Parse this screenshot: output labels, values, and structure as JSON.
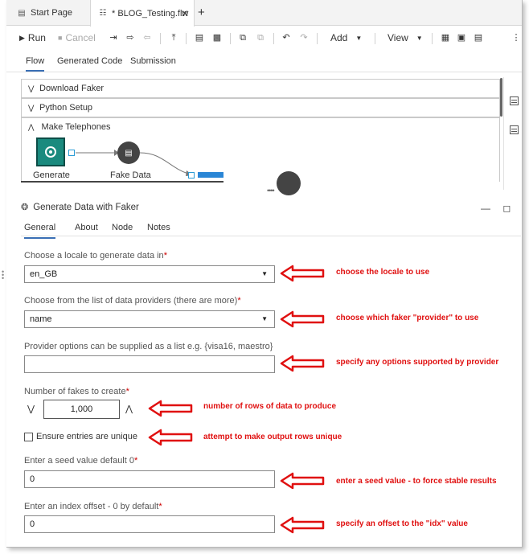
{
  "tabs": [
    {
      "label": "Start Page",
      "icon": "start-page-icon"
    },
    {
      "label": "* BLOG_Testing.flw",
      "icon": "flow-icon"
    }
  ],
  "toolbar": {
    "run": "Run",
    "cancel": "Cancel",
    "add": "Add",
    "view": "View"
  },
  "subtabs": [
    "Flow",
    "Generated Code",
    "Submission"
  ],
  "flow": {
    "rows": [
      "Download Faker",
      "Python Setup"
    ],
    "make_title": "Make Telephones",
    "node_generate": "Generate",
    "node_fake": "Fake  Data"
  },
  "panel": {
    "title": "Generate Data with Faker",
    "tabs": [
      "General",
      "About",
      "Node",
      "Notes"
    ]
  },
  "fields": {
    "locale_label": "Choose a locale to generate data in",
    "locale_value": "en_GB",
    "provider_label": "Choose from the list of data providers (there are more)",
    "provider_value": "name",
    "options_label": "Provider options can be supplied as a list e.g. {visa16, maestro}",
    "options_value": "",
    "fakes_label": "Number of fakes to create",
    "fakes_value": "1,000",
    "unique_label": "Ensure entries are unique",
    "seed_label": "Enter a seed value default 0",
    "seed_value": "0",
    "offset_label": "Enter an index offset  - 0 by default",
    "offset_value": "0",
    "required_mark": "*"
  },
  "annotations": [
    "choose the locale to use",
    "choose which faker \"provider\" to use",
    "specify any options supported by provider",
    "number of rows of data to produce",
    "attempt to make output rows unique",
    "enter a seed value - to force stable results",
    "specify an offset to the \"idx\" value"
  ],
  "colors": {
    "annotation": "#e01010",
    "node_generate": "#1a8a7e",
    "accent": "#3a6fb5"
  }
}
